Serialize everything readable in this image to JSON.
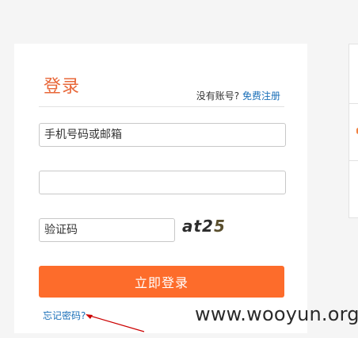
{
  "login": {
    "title": "登录",
    "no_account_text": "没有账号?",
    "register_link": "免费注册",
    "account_placeholder": "手机号码或邮箱",
    "password_value": "",
    "captcha_placeholder": "验证码",
    "captcha_text_main": "at2",
    "captcha_text_tail": "5",
    "submit_label": "立即登录",
    "forgot_link": "忘记密码?"
  },
  "watermark": "www.wooyun.org",
  "colors": {
    "accent": "#fd6c2b",
    "title": "#e8683a",
    "link": "#1a6fb8",
    "annotation_arrow": "#cc0000"
  }
}
